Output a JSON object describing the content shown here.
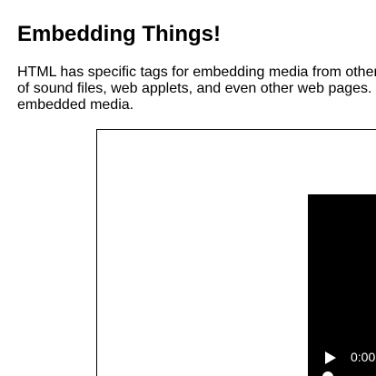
{
  "page": {
    "title": "Embedding Things!",
    "intro_lines": [
      "HTML has specific tags for embedding media from other",
      "of sound files, web applets, and even other web pages.",
      "embedded media."
    ]
  },
  "video": {
    "current_time": "0:00",
    "icons": {
      "play": "play-icon",
      "seek": "progress-thumb"
    },
    "progress": 0
  },
  "colors": {
    "background": "#ffffff",
    "text": "#000000",
    "player_background": "#000000",
    "player_controls": "#ffffff"
  }
}
